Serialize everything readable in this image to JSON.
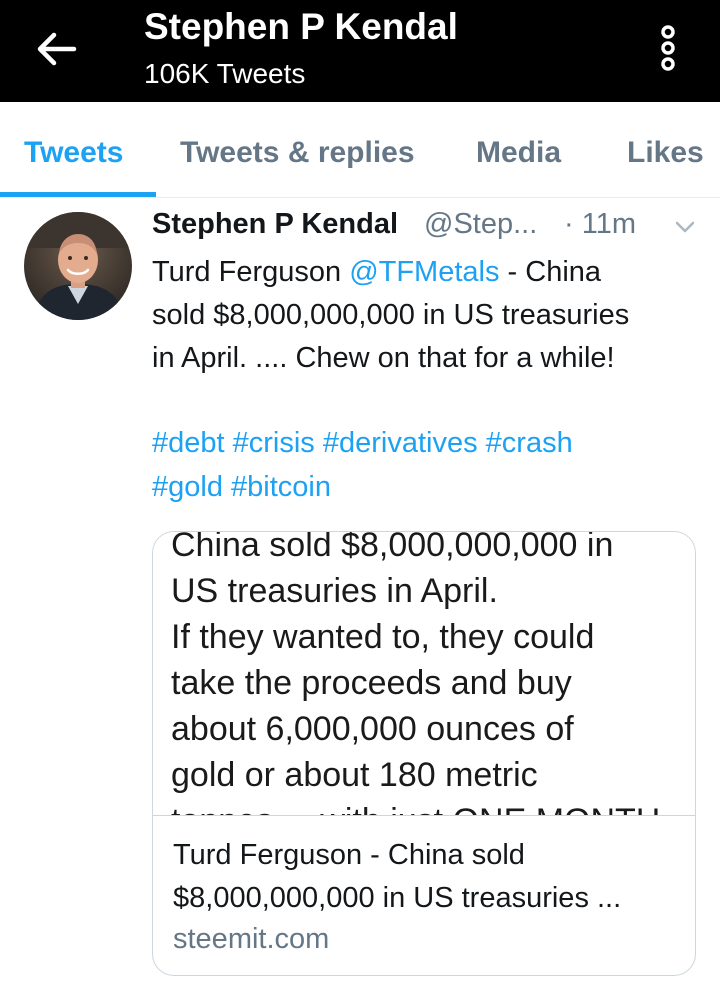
{
  "header": {
    "title": "Stephen P Kendal",
    "subtitle": "106K Tweets",
    "back_icon": "arrow-left-icon",
    "more_icon": "more-vertical-icon"
  },
  "tabs": [
    {
      "label": "Tweets",
      "active": true
    },
    {
      "label": "Tweets & replies",
      "active": false
    },
    {
      "label": "Media",
      "active": false
    },
    {
      "label": "Likes",
      "active": false
    }
  ],
  "tweet": {
    "name": "Stephen P Kendal",
    "handle": "@Step...",
    "time": "· 11m",
    "text": {
      "prefix": "Turd Ferguson ",
      "mention": "@TFMetals",
      "line1_suffix": " - China",
      "line2": "sold $8,000,000,000 in US treasuries",
      "line3": "in April. .... Chew on that for a while!"
    },
    "hashtags": {
      "line1": "#debt #crisis #derivatives #crash",
      "line2": "#gold #bitcoin"
    },
    "card": {
      "image_text": [
        "China sold $8,000,000,000 in",
        "US treasuries in April.",
        "If they wanted to, they could",
        "take the proceeds and buy",
        "about 6,000,000 ounces of",
        "gold or about 180 metric",
        "tonnes ... with just ONE MONTH"
      ],
      "title_line1": "Turd Ferguson - China sold",
      "title_line2": "$8,000,000,000 in US treasuries ...",
      "domain": "steemit.com"
    }
  },
  "colors": {
    "accent": "#1da1f2",
    "header_bg": "#000000",
    "secondary_text": "#657786"
  }
}
